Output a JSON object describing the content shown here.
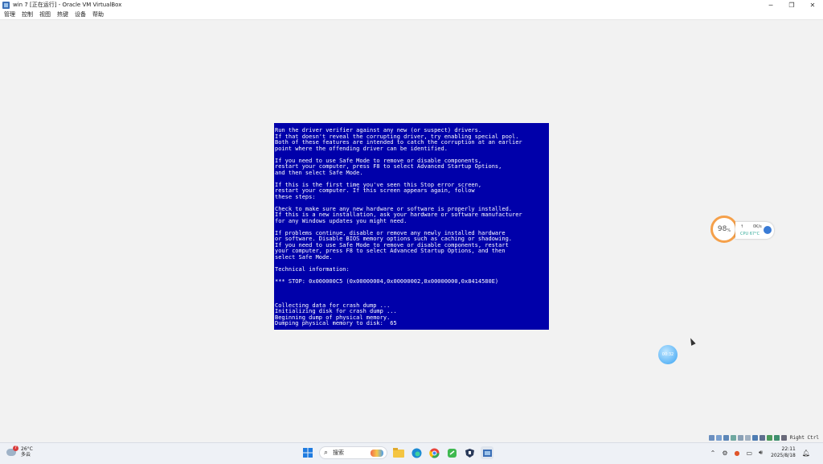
{
  "window": {
    "title": "win 7 [正在运行] - Oracle VM VirtualBox",
    "controls": {
      "minimize": "─",
      "restore": "❐",
      "close": "✕"
    }
  },
  "menu": [
    "管理",
    "控制",
    "视图",
    "热键",
    "设备",
    "帮助"
  ],
  "bsod": {
    "background": "#0000aa",
    "lines": [
      "Run the driver verifier against any new (or suspect) drivers.",
      "If that doesn't reveal the corrupting driver, try enabling special pool.",
      "Both of these features are intended to catch the corruption at an earlier",
      "point where the offending driver can be identified.",
      "",
      "If you need to use Safe Mode to remove or disable components,",
      "restart your computer, press F8 to select Advanced Startup Options,",
      "and then select Safe Mode.",
      "",
      "If this is the first time you've seen this Stop error screen,",
      "restart your computer. If this screen appears again, follow",
      "these steps:",
      "",
      "Check to make sure any new hardware or software is properly installed.",
      "If this is a new installation, ask your hardware or software manufacturer",
      "for any Windows updates you might need.",
      "",
      "If problems continue, disable or remove any newly installed hardware",
      "or software. Disable BIOS memory options such as caching or shadowing.",
      "If you need to use Safe Mode to remove or disable components, restart",
      "your computer, press F8 to select Advanced Startup Options, and then",
      "select Safe Mode.",
      "",
      "Technical information:",
      "",
      "*** STOP: 0x000000C5 (0x00000004,0x00000002,0x00000000,0x8414580E)",
      "",
      "",
      "",
      "Collecting data for crash dump ...",
      "Initializing disk for crash dump ...",
      "Beginning dump of physical memory.",
      "Dumping physical memory to disk:  65"
    ]
  },
  "widget": {
    "gauge_value": "98",
    "gauge_unit": "%",
    "net_arrow": "↑",
    "net_speed": "0K/s",
    "cpu_label": "CPU 67°C"
  },
  "bubble_text": "00:32",
  "statusbar": {
    "hotkey": "Right Ctrl"
  },
  "taskbar": {
    "weather_temp": "26°C",
    "weather_desc": "多云",
    "weather_badge": "7",
    "search_text": "搜索",
    "time": "22:11",
    "date": "2025/8/18"
  }
}
